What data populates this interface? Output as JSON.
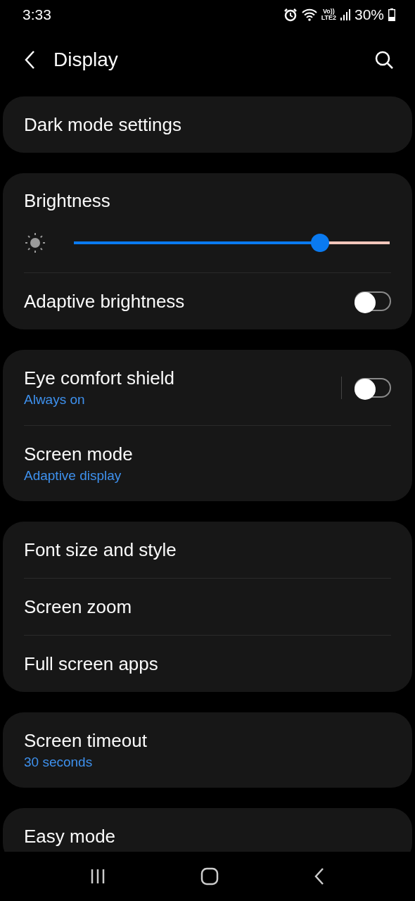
{
  "status_bar": {
    "time": "3:33",
    "network_label": [
      "Vo))",
      "LTE2"
    ],
    "battery": "30%"
  },
  "header": {
    "title": "Display"
  },
  "sections": [
    {
      "items": [
        {
          "kind": "link",
          "label": "Dark mode settings"
        }
      ]
    },
    {
      "items": [
        {
          "kind": "slider",
          "label": "Brightness",
          "level": 0.78
        },
        {
          "kind": "toggle",
          "label": "Adaptive brightness",
          "on": false
        }
      ]
    },
    {
      "items": [
        {
          "kind": "split-toggle",
          "label": "Eye comfort shield",
          "subtitle": "Always on",
          "on": false
        },
        {
          "kind": "link",
          "label": "Screen mode",
          "subtitle": "Adaptive display"
        }
      ]
    },
    {
      "items": [
        {
          "kind": "link",
          "label": "Font size and style"
        },
        {
          "kind": "link",
          "label": "Screen zoom"
        },
        {
          "kind": "link",
          "label": "Full screen apps"
        }
      ]
    },
    {
      "items": [
        {
          "kind": "link",
          "label": "Screen timeout",
          "subtitle": "30 seconds"
        }
      ]
    },
    {
      "items": [
        {
          "kind": "link",
          "label": "Easy mode"
        }
      ]
    }
  ]
}
